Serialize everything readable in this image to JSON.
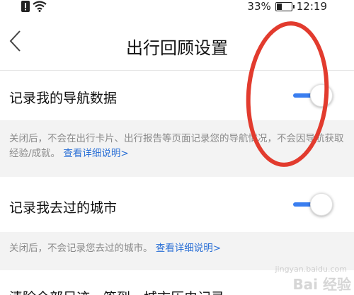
{
  "status_bar": {
    "battery_text": "33%",
    "battery_level": 0.33,
    "time": "12:19"
  },
  "header": {
    "title": "出行回顾设置"
  },
  "settings": [
    {
      "label": "记录我的导航数据",
      "enabled": true,
      "description": "关闭后，不会在出行卡片、出行报告等页面记录您的导航情况，不会因导航获取经验/成就。",
      "link": "查看详细说明>"
    },
    {
      "label": "记录我去过的城市",
      "enabled": true,
      "description": "关闭后，不会记录您去过的城市。",
      "link": "查看详细说明>"
    }
  ],
  "partial_row": {
    "label": "清除全部足迹、签到、城市历史记录"
  },
  "watermark": {
    "text": "Bai 经验",
    "url": "jingyan.baidu.com"
  },
  "colors": {
    "toggle_on": "#3a7ef0",
    "link": "#2a6fd6",
    "annotation": "#e23b2e"
  }
}
